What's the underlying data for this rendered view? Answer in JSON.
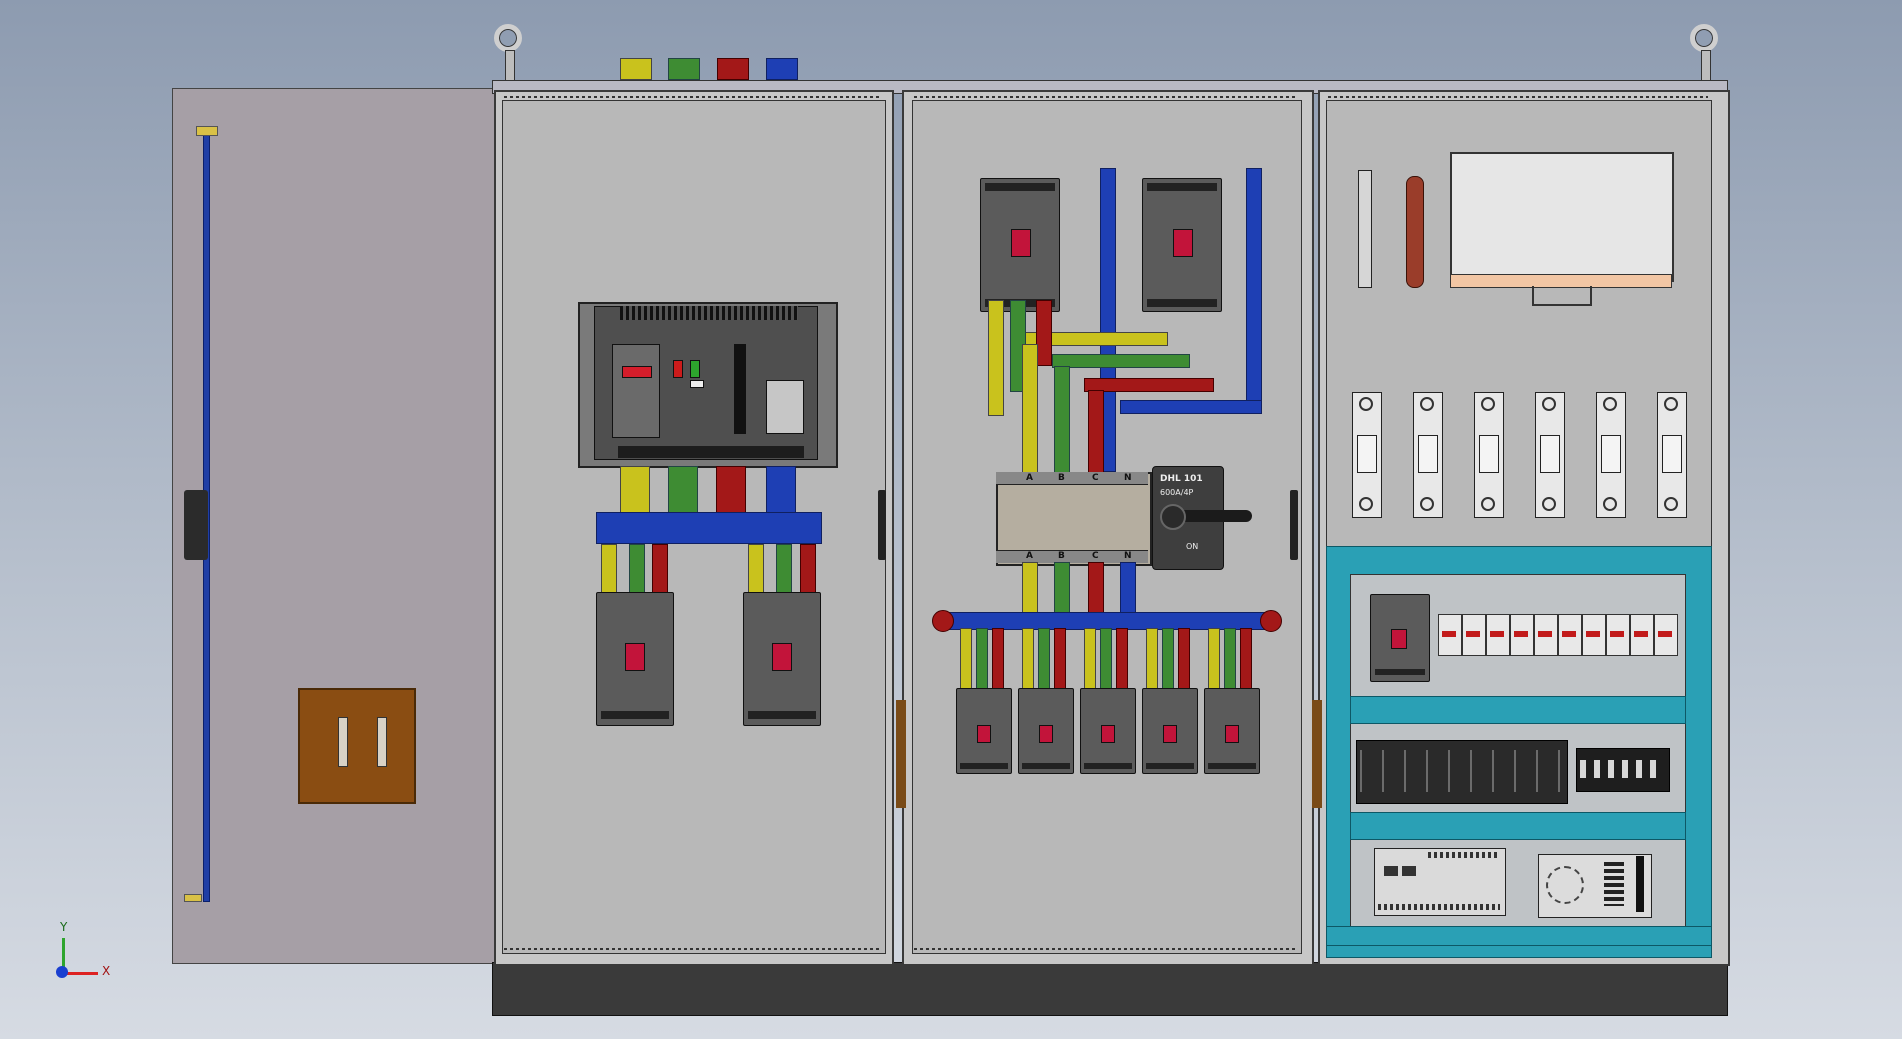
{
  "view": {
    "axis_triad": {
      "y_label": "Y",
      "x_label": "X"
    }
  },
  "colors": {
    "phase_a": "#c9c21d",
    "phase_b": "#3e8c33",
    "phase_c": "#a31818",
    "neutral": "#1e3fb4",
    "din_rail_tray": "#2aa0b5",
    "door": "#a69fa6",
    "plinth": "#3a3a3a"
  },
  "top_indicators": [
    "yellow-block",
    "green-block",
    "red-block",
    "blue-block"
  ],
  "panel2": {
    "isolator_phase_labels_top": [
      "A",
      "B",
      "C",
      "N"
    ],
    "isolator_phase_labels_bottom": [
      "A",
      "B",
      "C",
      "N"
    ],
    "isolator_handle_text": "DHL 101",
    "isolator_sub_text": "600A/4P",
    "isolator_pos": "ON"
  },
  "counts": {
    "panel2_outgoing_breakers": 5,
    "panel3_fuse_holders": 6,
    "panel3_mcbs": 10
  }
}
